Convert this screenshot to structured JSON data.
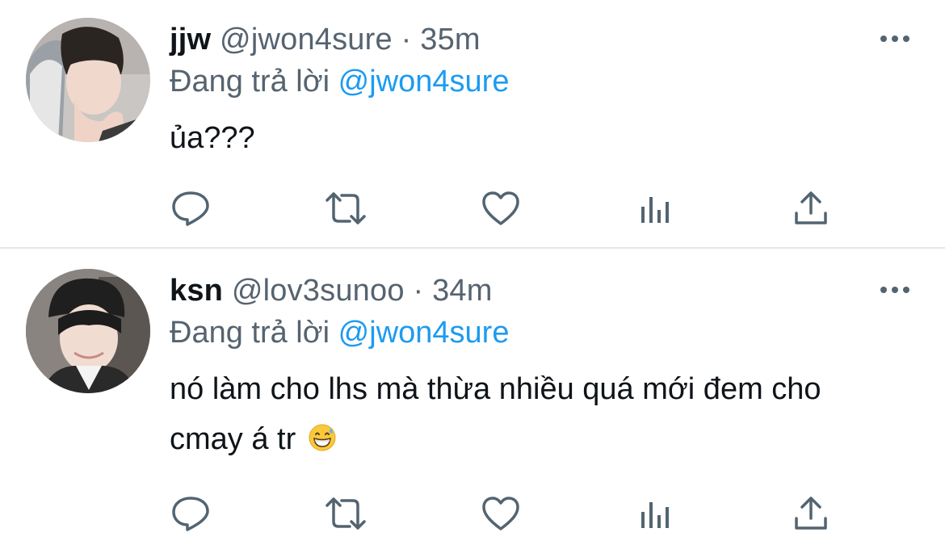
{
  "tweets": [
    {
      "display_name": "jjw",
      "handle": "@jwon4sure",
      "separator": "·",
      "time": "35m",
      "replying_prefix": "Đang trả lời",
      "replying_to": "@jwon4sure",
      "text": "ủa???",
      "emoji": null
    },
    {
      "display_name": "ksn",
      "handle": "@lov3sunoo",
      "separator": "·",
      "time": "34m",
      "replying_prefix": "Đang trả lời",
      "replying_to": "@jwon4sure",
      "text": "nó làm cho lhs mà thừa nhiều quá mới đem cho cmay á tr",
      "emoji": "grinning-face-with-sweat"
    }
  ],
  "icons": {
    "more": "more-horizontal-icon",
    "reply": "reply-bubble-icon",
    "retweet": "retweet-icon",
    "like": "heart-icon",
    "views": "bar-chart-icon",
    "share": "share-upload-icon"
  },
  "colors": {
    "text": "#0f1419",
    "secondary": "#566370",
    "mention": "#1d9bf0",
    "icon": "#536471",
    "divider": "#e1e6ea"
  }
}
